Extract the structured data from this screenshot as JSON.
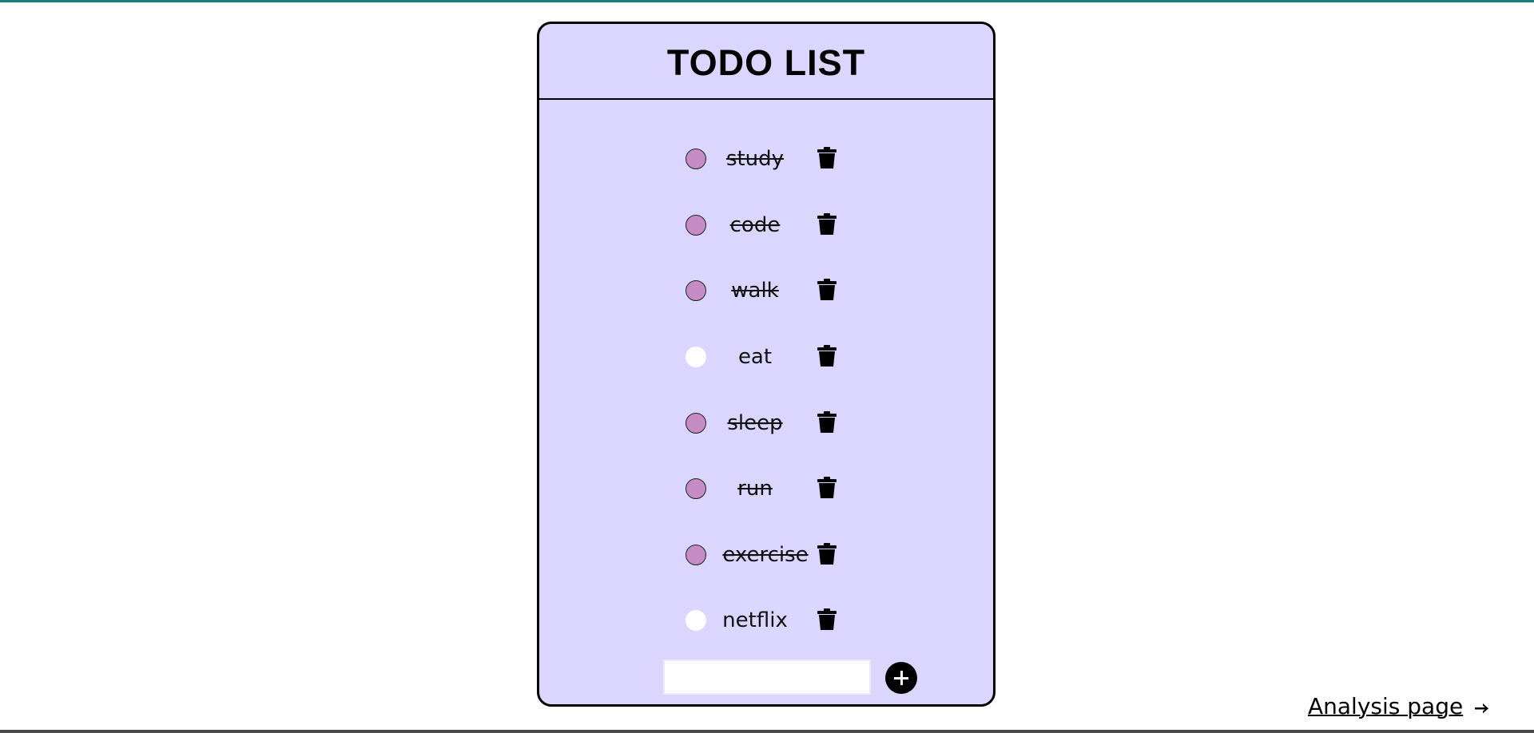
{
  "header": {
    "title": "TODO LIST"
  },
  "todos": [
    {
      "label": "study",
      "done": true
    },
    {
      "label": "code",
      "done": true
    },
    {
      "label": "walk",
      "done": true
    },
    {
      "label": "eat",
      "done": false
    },
    {
      "label": "sleep",
      "done": true
    },
    {
      "label": "run",
      "done": true
    },
    {
      "label": "exercise",
      "done": true
    },
    {
      "label": "netflix",
      "done": false
    }
  ],
  "add": {
    "input_value": "",
    "input_placeholder": "",
    "button_icon": "plus-icon"
  },
  "footer": {
    "analysis_link": "Analysis page",
    "arrow_icon": "arrow-right-icon"
  },
  "colors": {
    "card_bg": "#dbd6ff",
    "done_check": "#c48bc4",
    "open_check": "#ffffff",
    "topbar": "#1b7f80"
  }
}
